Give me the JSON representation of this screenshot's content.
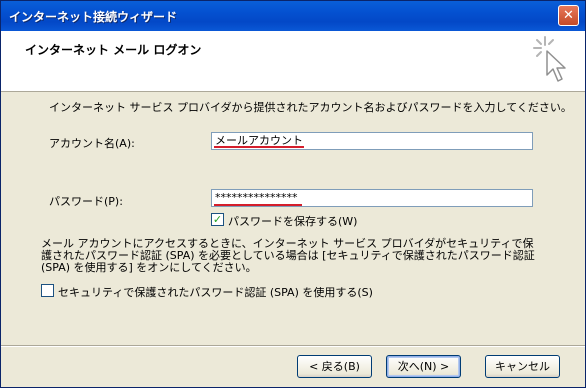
{
  "window": {
    "title": "インターネット接続ウィザード",
    "close_glyph": "✕"
  },
  "header": {
    "title": "インターネット メール ログオン",
    "icon": "sparkle-cursor-icon"
  },
  "instruction": "インターネット サービス プロバイダから提供されたアカウント名およびパスワードを入力してください。",
  "account": {
    "label": "アカウント名(A):",
    "value": "メールアカウント"
  },
  "password": {
    "label": "パスワード(P):",
    "value": "***************"
  },
  "save_password": {
    "label": "パスワードを保存する(W)",
    "checked": true
  },
  "spa_description": "メール アカウントにアクセスするときに、インターネット サービス プロバイダがセキュリティで保護されたパスワード認証 (SPA) を必要としている場合は [セキュリティで保護されたパスワード認証 (SPA) を使用する] をオンにしてください。",
  "spa_checkbox": {
    "label": "セキュリティで保護されたパスワード認証 (SPA) を使用する(S)",
    "checked": false
  },
  "buttons": {
    "back": "< 戻る(B)",
    "next": "次へ(N) >",
    "cancel": "キャンセル"
  },
  "colors": {
    "title_bar": "#0a58d6",
    "annotation_underline": "#d41e2b",
    "dialog_face": "#ece9d8"
  }
}
